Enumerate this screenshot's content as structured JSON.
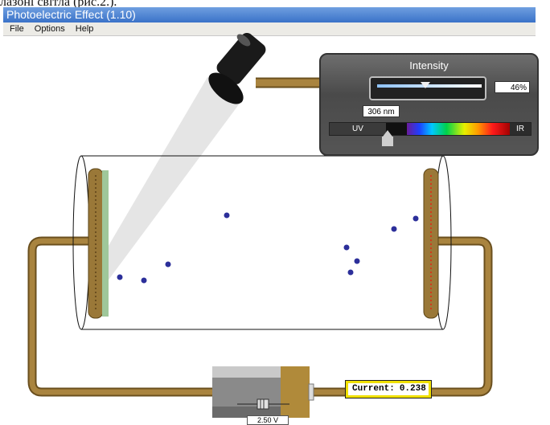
{
  "document_fragment": "лазоні світла (рис.2.).",
  "window": {
    "title": "Photoelectric Effect (1.10)"
  },
  "menu": [
    "File",
    "Options",
    "Help"
  ],
  "light_control": {
    "title": "Intensity",
    "intensity_fraction": 0.46,
    "intensity_label": "46%",
    "wavelength_label": "306 nm",
    "wavelength_fraction": 0.29,
    "uv_label": "UV",
    "ir_label": "IR"
  },
  "current": {
    "label": "Current:",
    "value": "0.238"
  },
  "voltage": {
    "label": "2.50 V"
  },
  "colors": {
    "wire": "#a9843f",
    "electron": "#2c2f9a",
    "beam": "#e4e4e4",
    "highlight": "#f0e000"
  }
}
